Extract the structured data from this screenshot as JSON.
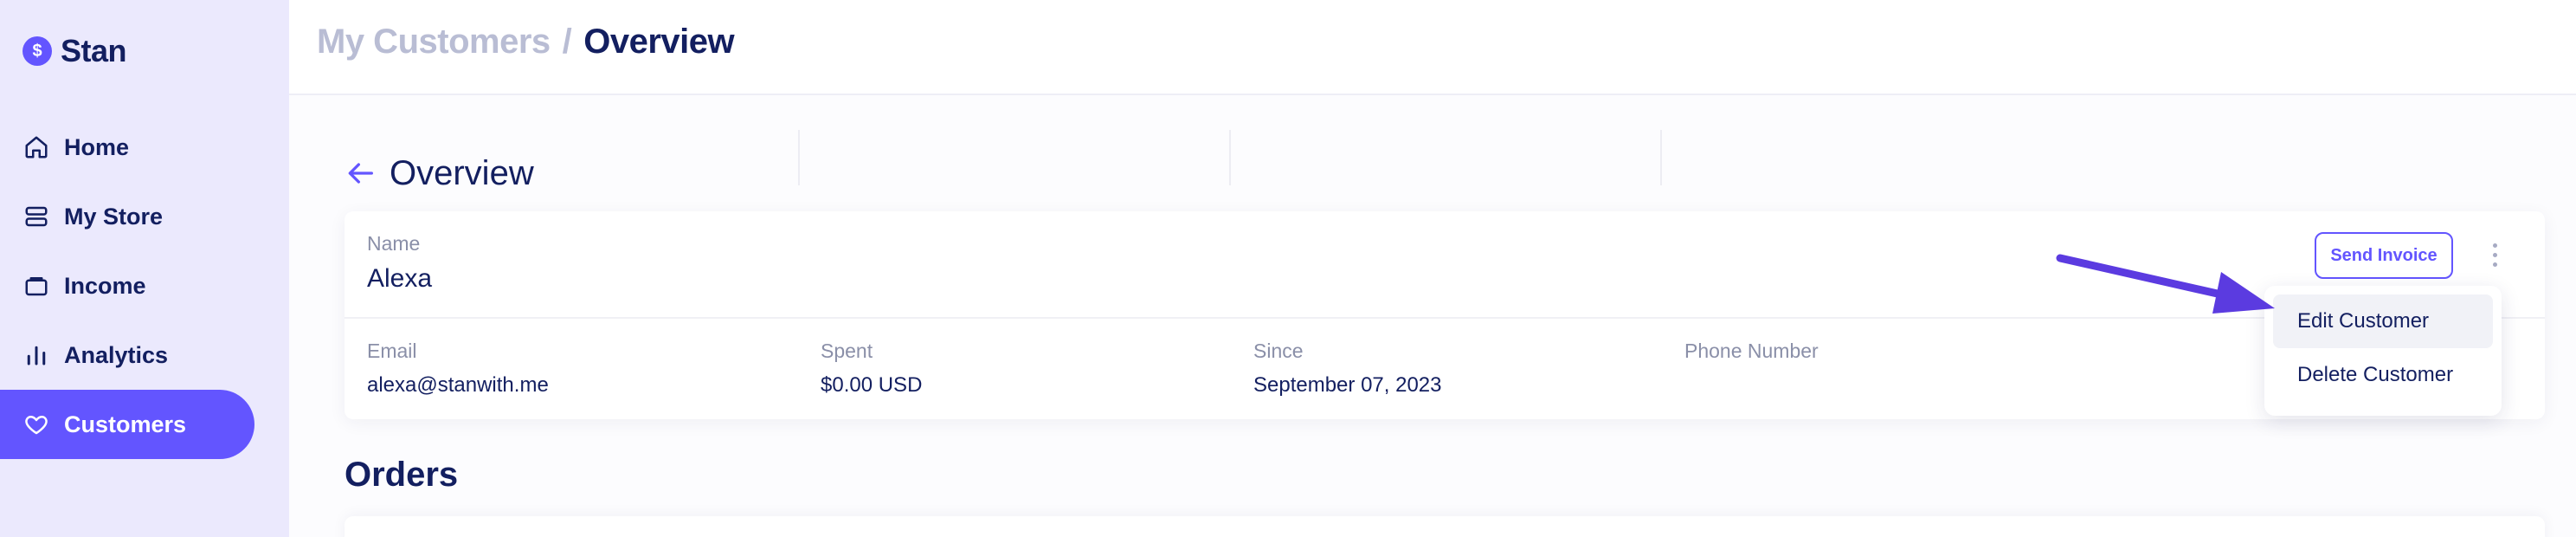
{
  "brand": {
    "logo_glyph": "$",
    "name": "Stan"
  },
  "sidebar": {
    "items": [
      {
        "label": "Home",
        "icon": "home-icon",
        "active": false
      },
      {
        "label": "My Store",
        "icon": "store-icon",
        "active": false
      },
      {
        "label": "Income",
        "icon": "wallet-icon",
        "active": false
      },
      {
        "label": "Analytics",
        "icon": "bar-chart-icon",
        "active": false
      },
      {
        "label": "Customers",
        "icon": "heart-icon",
        "active": true
      }
    ]
  },
  "header": {
    "parent": "My Customers",
    "separator": "/",
    "current": "Overview"
  },
  "page": {
    "title": "Overview",
    "orders_title": "Orders"
  },
  "customer": {
    "name_label": "Name",
    "name": "Alexa",
    "email_label": "Email",
    "email": "alexa@stanwith.me",
    "spent_label": "Spent",
    "spent": "$0.00 USD",
    "since_label": "Since",
    "since": "September 07, 2023",
    "phone_label": "Phone Number",
    "phone": ""
  },
  "actions": {
    "send_invoice": "Send Invoice"
  },
  "menu": {
    "items": [
      "Edit Customer",
      "Delete Customer"
    ],
    "highlighted": "Edit Customer"
  },
  "colors": {
    "accent": "#6355ff",
    "navy": "#131f60",
    "sidebar_bg": "#ebe9fd",
    "arrow": "#5b3be0"
  }
}
